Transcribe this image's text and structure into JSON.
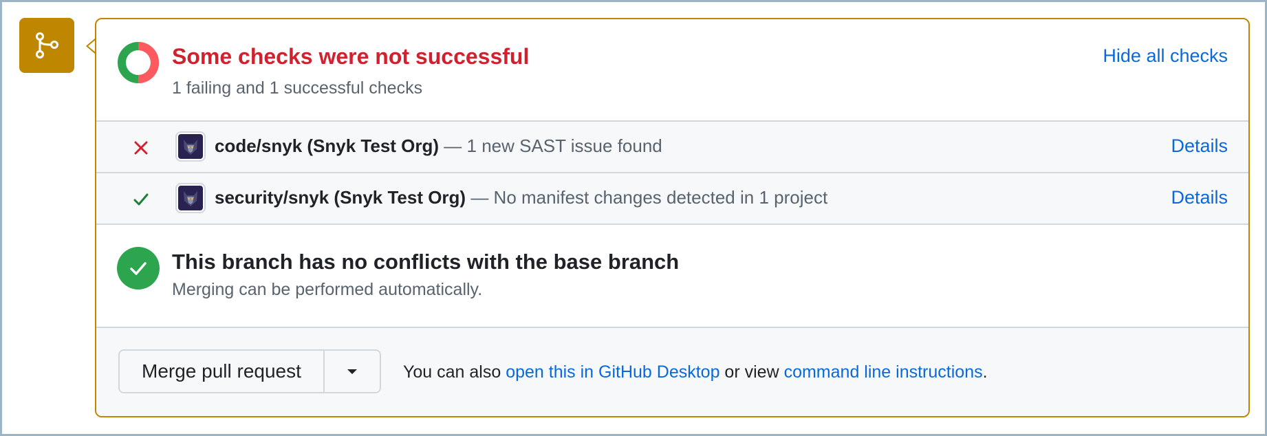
{
  "icons": {
    "merge_box": "git-branch-icon",
    "checks_status": "partial-status-donut-icon",
    "fail": "x-icon",
    "pass": "check-icon",
    "avatar": "snyk-avatar-icon",
    "no_conflicts": "check-circle-icon",
    "dropdown": "triangle-down-icon"
  },
  "colors": {
    "merge_accent": "#bf8700",
    "fail_red": "#cf222e",
    "success_green": "#2da44e",
    "link_blue": "#0969da",
    "donut_red": "#ff5a5f",
    "donut_green": "#2da44e"
  },
  "checks": {
    "title": "Some checks were not successful",
    "subtitle": "1 failing and 1 successful checks",
    "hide_link": "Hide all checks",
    "donut": {
      "failing": 1,
      "successful": 1
    },
    "items": [
      {
        "status": "failing",
        "name": "code/snyk (Snyk Test Org)",
        "description": " — 1 new SAST issue found",
        "details_label": "Details"
      },
      {
        "status": "success",
        "name": "security/snyk (Snyk Test Org)",
        "description": " — No manifest changes detected in 1 project",
        "details_label": "Details"
      }
    ]
  },
  "conflicts": {
    "title": "This branch has no conflicts with the base branch",
    "subtitle": "Merging can be performed automatically."
  },
  "merge": {
    "button_label": "Merge pull request",
    "note_prefix": "You can also ",
    "desktop_link": "open this in GitHub Desktop",
    "note_middle": " or view ",
    "cli_link": "command line instructions",
    "note_suffix": "."
  }
}
